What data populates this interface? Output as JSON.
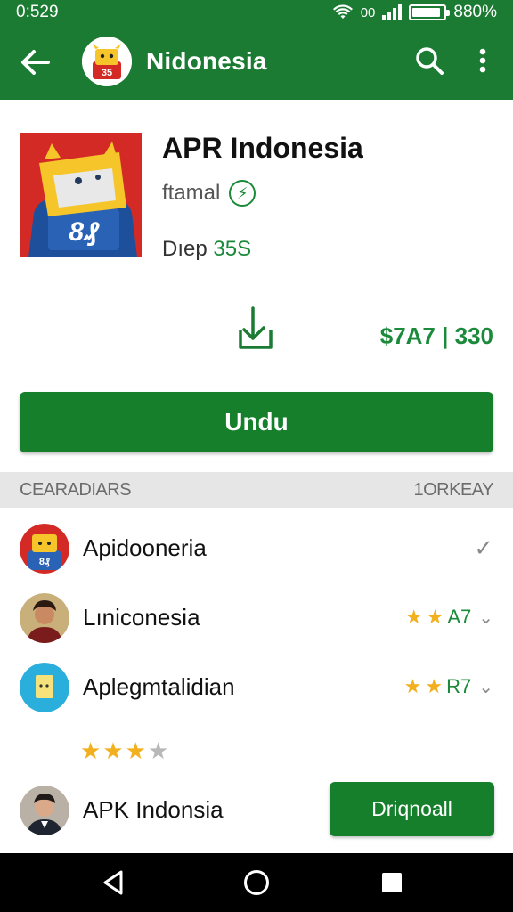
{
  "status_bar": {
    "time": "0:529",
    "network": "00",
    "battery": "880%",
    "battery_level": 0.9
  },
  "app_bar": {
    "title": "Nidonesia",
    "icons": [
      "back-arrow-icon",
      "app-logo",
      "search-icon",
      "more-vert-icon"
    ]
  },
  "app": {
    "name": "APR Indonesia",
    "developer": "ftamal",
    "size_label": "Dıep",
    "size_value": "35S",
    "price": "$7A7 | 330",
    "install_label": "Undu"
  },
  "section": {
    "left": "CEARADIARS",
    "right": "1ORKEAY"
  },
  "list": {
    "items": [
      {
        "label": "Apidooneria",
        "meta": "",
        "stars": 0,
        "trailing": "check"
      },
      {
        "label": "Lıniconesia",
        "meta": "A7",
        "stars": 2,
        "trailing": "chevron"
      },
      {
        "label": "Aplegmtalidian",
        "meta": "R7",
        "stars": 2,
        "trailing": "chevron"
      },
      {
        "label": "APK Indonsia",
        "meta": "",
        "stars": 0,
        "trailing": "button"
      }
    ],
    "loose_rating": {
      "filled": 3,
      "total": 4
    },
    "cta_label": "Driqnoall"
  },
  "colors": {
    "brand_green": "#1b7b33",
    "button_green": "#167f2c",
    "accent_green": "#1b8a3a",
    "star_gold": "#f2b01e",
    "icon_red": "#d42a26"
  }
}
